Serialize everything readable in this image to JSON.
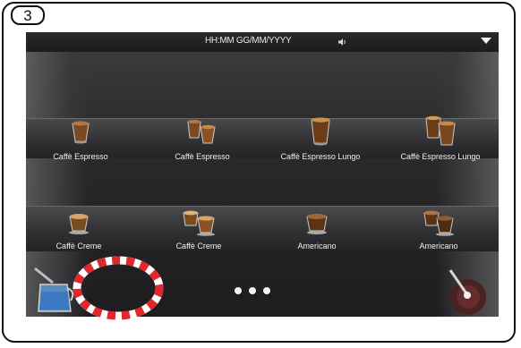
{
  "step_badge": "3",
  "status_bar": {
    "datetime": "HH:MM GG/MM/YYYY",
    "volume_icon": "speaker-icon",
    "menu_icon": "chevron-down-icon"
  },
  "products_row1": [
    {
      "label": "Caffè Espresso",
      "icon": "single-espresso-cup-icon"
    },
    {
      "label": "Caffè Espresso",
      "icon": "double-espresso-cup-icon"
    },
    {
      "label": "Caffè Espresso Lungo",
      "icon": "single-lungo-cup-icon"
    },
    {
      "label": "Caffè Espresso Lungo",
      "icon": "double-lungo-cup-icon"
    }
  ],
  "products_row2": [
    {
      "label": "Caffè Creme",
      "icon": "single-creme-cup-icon"
    },
    {
      "label": "Caffè Creme",
      "icon": "double-creme-cup-icon"
    },
    {
      "label": "Americano",
      "icon": "single-americano-cup-icon"
    },
    {
      "label": "Americano",
      "icon": "double-americano-cup-icon"
    }
  ],
  "pager": {
    "pages": 3
  },
  "bottom": {
    "left_icon": "milk-jug-icon",
    "right_icon": "steam-wand-icon"
  },
  "colors": {
    "screen_bg": "#2b2b2d",
    "highlight_red": "#e0282c",
    "label_text": "#f0f0f0"
  }
}
